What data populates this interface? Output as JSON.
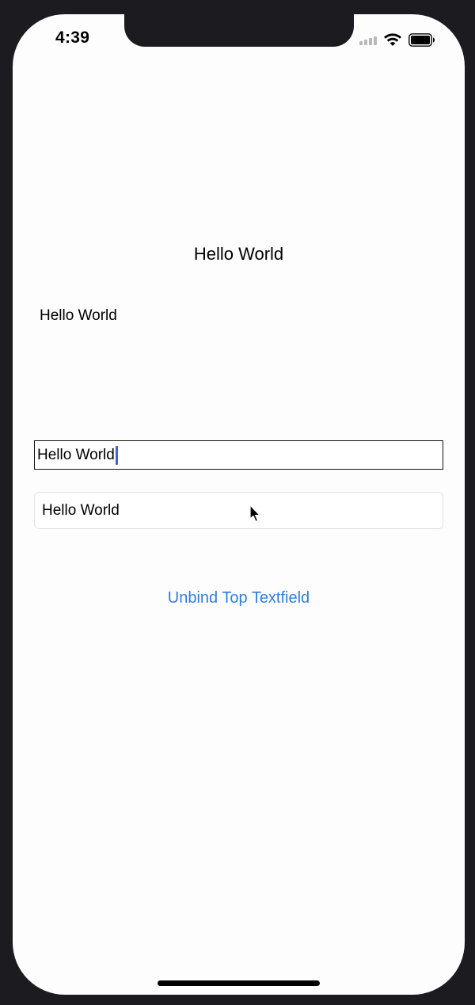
{
  "status_bar": {
    "time": "4:39",
    "icons": [
      "cellular-signal-icon",
      "wifi-icon",
      "battery-icon"
    ]
  },
  "labels": {
    "centered": "Hello World",
    "left": "Hello World"
  },
  "textfields": {
    "top": {
      "value": "Hello World",
      "focused": true
    },
    "bottom": {
      "value": "Hello World"
    }
  },
  "button": {
    "unbind_label": "Unbind Top Textfield"
  },
  "colors": {
    "accent": "#2f7de1",
    "caret": "#3a63d6",
    "frame": "#1c1b1f",
    "background": "#fefdfe"
  }
}
